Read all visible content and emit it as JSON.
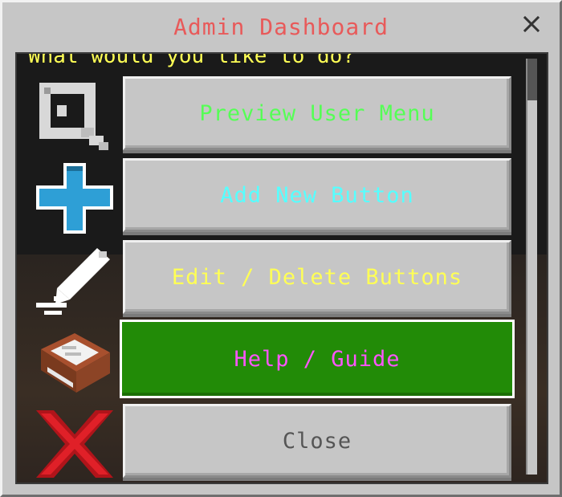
{
  "window": {
    "title": "Admin Dashboard",
    "close_glyph": "✕"
  },
  "prompt": "What would you like to do?",
  "menu": [
    {
      "label": "Preview User Menu",
      "color": "#55ff55",
      "icon": "magnifier-icon"
    },
    {
      "label": "Add New Button",
      "color": "#55ffff",
      "icon": "plus-icon"
    },
    {
      "label": "Edit / Delete Buttons",
      "color": "#ffff55",
      "icon": "pencil-icon"
    },
    {
      "label": "Help / Guide",
      "color": "#ff55ff",
      "icon": "book-icon",
      "selected": true
    },
    {
      "label": "Close",
      "color": "#555555",
      "icon": "red-x-icon"
    }
  ],
  "colors": {
    "title": "#e85a5a",
    "selected_button": "#228b07",
    "button_face": "#c6c6c6"
  }
}
